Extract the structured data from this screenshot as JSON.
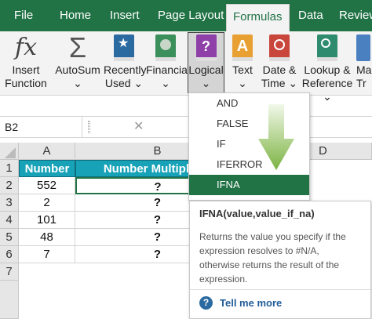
{
  "tabs": [
    {
      "label": "File"
    },
    {
      "label": "Home"
    },
    {
      "label": "Insert"
    },
    {
      "label": "Page Layout"
    },
    {
      "label": "Formulas",
      "active": true
    },
    {
      "label": "Data"
    },
    {
      "label": "Review"
    }
  ],
  "ribbon": {
    "fx_glyph": "fx",
    "sigma_glyph": "Σ",
    "question_glyph": "?",
    "a_glyph": "A",
    "insert_function": {
      "line1": "Insert",
      "line2": "Function"
    },
    "autosum": {
      "label": "AutoSum",
      "caret": "⌄"
    },
    "recently_used": {
      "line1": "Recently",
      "line2": "Used ⌄"
    },
    "financial": {
      "label": "Financial",
      "caret": "⌄"
    },
    "logical": {
      "label": "Logical",
      "caret": "⌄"
    },
    "text": {
      "label": "Text",
      "caret": "⌄"
    },
    "date_time": {
      "line1": "Date &",
      "line2": "Time ⌄"
    },
    "lookup_reference": {
      "line1": "Lookup &",
      "line2": "Reference ⌄"
    },
    "math": {
      "line1": "Ma",
      "line2": "Tr"
    }
  },
  "formula_bar": {
    "name_box": "B2",
    "cancel_glyph": "✕"
  },
  "columns": [
    "A",
    "B",
    "D"
  ],
  "rows": [
    "1",
    "2",
    "3",
    "4",
    "5",
    "6",
    "7",
    ""
  ],
  "table": {
    "headers": [
      "Number",
      "Number Multiple Of"
    ],
    "rows": [
      [
        "552",
        "?"
      ],
      [
        "2",
        "?"
      ],
      [
        "101",
        "?"
      ],
      [
        "48",
        "?"
      ],
      [
        "7",
        "?"
      ]
    ]
  },
  "logical_menu": {
    "items": [
      "AND",
      "FALSE",
      "IF",
      "IFERROR",
      "IFNA"
    ],
    "highlighted": "IFNA"
  },
  "tooltip": {
    "signature": "IFNA(value,value_if_na)",
    "description_lines": [
      "Returns the value you specify if the",
      "expression resolves to #N/A,",
      "otherwise returns the result of the",
      "expression."
    ],
    "help_glyph": "?",
    "link": "Tell me more"
  },
  "colors": {
    "excel_green": "#217346",
    "header_teal": "#17a2b8",
    "logical_purple": "#8e3fa8",
    "arrow_green": "#7cb342"
  }
}
